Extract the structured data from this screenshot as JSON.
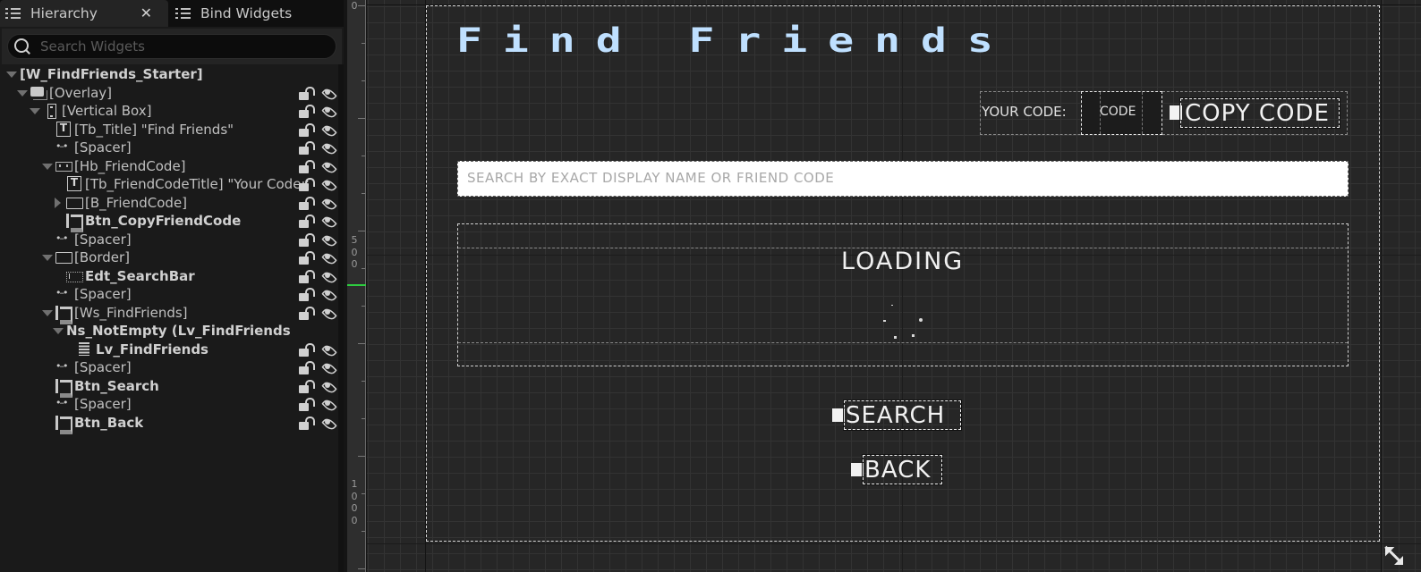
{
  "tabs": [
    {
      "label": "Hierarchy",
      "icon": "list-icon",
      "active": true,
      "closable": true
    },
    {
      "label": "Bind Widgets",
      "icon": "list-icon",
      "active": false
    }
  ],
  "tab_close_glyph": "✕",
  "search": {
    "placeholder": "Search Widgets",
    "value": ""
  },
  "hierarchy": [
    {
      "label": "[W_FindFriends_Starter]",
      "icon": "",
      "caret": "down",
      "bold": true,
      "depth": 0,
      "lock": false,
      "eye": false
    },
    {
      "label": "[Overlay]",
      "icon": "overlay",
      "caret": "down",
      "bold": false,
      "depth": 1,
      "lock": true,
      "eye": true
    },
    {
      "label": "[Vertical Box]",
      "icon": "vbox",
      "caret": "down",
      "bold": false,
      "depth": 2,
      "lock": true,
      "eye": true
    },
    {
      "label": "[Tb_Title] \"Find Friends\"",
      "icon": "text",
      "caret": "",
      "bold": false,
      "depth": 3,
      "lock": true,
      "eye": true
    },
    {
      "label": "[Spacer]",
      "icon": "spacer",
      "caret": "",
      "bold": false,
      "depth": 3,
      "lock": true,
      "eye": true
    },
    {
      "label": "[Hb_FriendCode]",
      "icon": "hbox",
      "caret": "down",
      "bold": false,
      "depth": 3,
      "lock": true,
      "eye": true
    },
    {
      "label": "[Tb_FriendCodeTitle] \"Your Code:\"",
      "icon": "text",
      "caret": "",
      "bold": false,
      "depth": 4,
      "lock": true,
      "eye": true
    },
    {
      "label": "[B_FriendCode]",
      "icon": "border",
      "caret": "right",
      "bold": false,
      "depth": 4,
      "lock": true,
      "eye": true
    },
    {
      "label": "Btn_CopyFriendCode",
      "icon": "button",
      "caret": "",
      "bold": true,
      "depth": 4,
      "lock": true,
      "eye": true
    },
    {
      "label": "[Spacer]",
      "icon": "spacer",
      "caret": "",
      "bold": false,
      "depth": 3,
      "lock": true,
      "eye": true
    },
    {
      "label": "[Border]",
      "icon": "border",
      "caret": "down",
      "bold": false,
      "depth": 3,
      "lock": true,
      "eye": true
    },
    {
      "label": "Edt_SearchBar",
      "icon": "edit",
      "caret": "",
      "bold": true,
      "depth": 4,
      "lock": true,
      "eye": true
    },
    {
      "label": "[Spacer]",
      "icon": "spacer",
      "caret": "",
      "bold": false,
      "depth": 3,
      "lock": true,
      "eye": true
    },
    {
      "label": "[Ws_FindFriends]",
      "icon": "button",
      "caret": "down",
      "bold": false,
      "depth": 3,
      "lock": true,
      "eye": true
    },
    {
      "label": "Ns_NotEmpty (Lv_FindFriends)",
      "icon": "",
      "caret": "down",
      "bold": true,
      "depth": 4,
      "lock": false,
      "eye": false
    },
    {
      "label": "Lv_FindFriends",
      "icon": "list",
      "caret": "",
      "bold": true,
      "depth": 5,
      "lock": true,
      "eye": true
    },
    {
      "label": "[Spacer]",
      "icon": "spacer",
      "caret": "",
      "bold": false,
      "depth": 3,
      "lock": true,
      "eye": true
    },
    {
      "label": "Btn_Search",
      "icon": "button",
      "caret": "",
      "bold": true,
      "depth": 3,
      "lock": true,
      "eye": true
    },
    {
      "label": "[Spacer]",
      "icon": "spacer",
      "caret": "",
      "bold": false,
      "depth": 3,
      "lock": true,
      "eye": true
    },
    {
      "label": "Btn_Back",
      "icon": "button",
      "caret": "",
      "bold": true,
      "depth": 3,
      "lock": true,
      "eye": true
    }
  ],
  "ruler": {
    "labels": [
      "0",
      "500",
      "1000"
    ]
  },
  "designer": {
    "title": "Find Friends",
    "title_color": "#bfe0ff",
    "your_code_label": "YOUR CODE:",
    "code_value": "CODE",
    "copy_code_button": "COPY CODE",
    "search_placeholder": "SEARCH BY EXACT DISPLAY NAME OR FRIEND CODE",
    "search_value": "",
    "loading_text": "LOADING",
    "search_button": "SEARCH",
    "back_button": "BACK"
  }
}
